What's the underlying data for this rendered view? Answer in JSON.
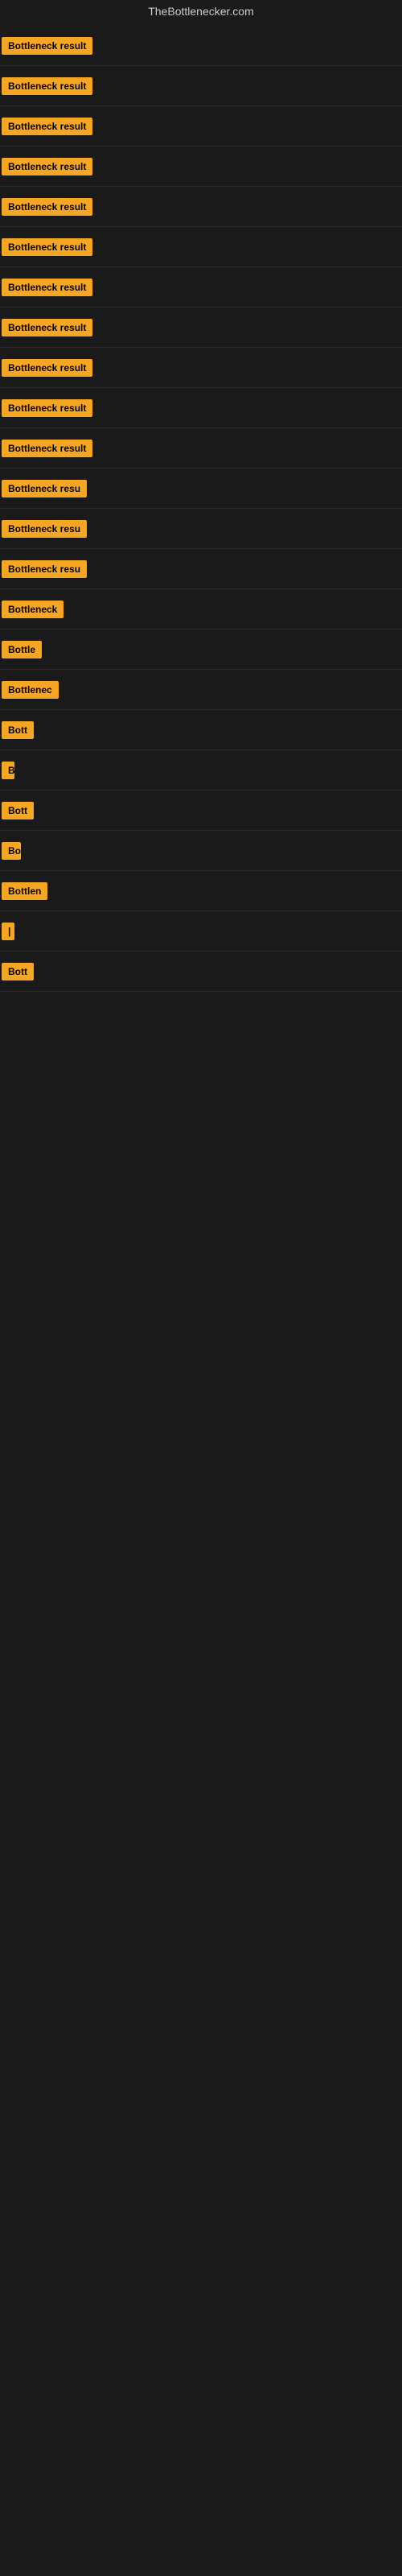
{
  "site": {
    "title": "TheBottlenecker.com"
  },
  "rows": [
    {
      "id": 1,
      "label": "Bottleneck result",
      "width": 155
    },
    {
      "id": 2,
      "label": "Bottleneck result",
      "width": 155
    },
    {
      "id": 3,
      "label": "Bottleneck result",
      "width": 155
    },
    {
      "id": 4,
      "label": "Bottleneck result",
      "width": 155
    },
    {
      "id": 5,
      "label": "Bottleneck result",
      "width": 155
    },
    {
      "id": 6,
      "label": "Bottleneck result",
      "width": 155
    },
    {
      "id": 7,
      "label": "Bottleneck result",
      "width": 155
    },
    {
      "id": 8,
      "label": "Bottleneck result",
      "width": 155
    },
    {
      "id": 9,
      "label": "Bottleneck result",
      "width": 155
    },
    {
      "id": 10,
      "label": "Bottleneck result",
      "width": 155
    },
    {
      "id": 11,
      "label": "Bottleneck result",
      "width": 155
    },
    {
      "id": 12,
      "label": "Bottleneck resu",
      "width": 130
    },
    {
      "id": 13,
      "label": "Bottleneck resu",
      "width": 130
    },
    {
      "id": 14,
      "label": "Bottleneck resu",
      "width": 130
    },
    {
      "id": 15,
      "label": "Bottleneck",
      "width": 90
    },
    {
      "id": 16,
      "label": "Bottle",
      "width": 55
    },
    {
      "id": 17,
      "label": "Bottlenec",
      "width": 80
    },
    {
      "id": 18,
      "label": "Bott",
      "width": 42
    },
    {
      "id": 19,
      "label": "B",
      "width": 14
    },
    {
      "id": 20,
      "label": "Bott",
      "width": 42
    },
    {
      "id": 21,
      "label": "Bo",
      "width": 24
    },
    {
      "id": 22,
      "label": "Bottlen",
      "width": 65
    },
    {
      "id": 23,
      "label": "|",
      "width": 8
    },
    {
      "id": 24,
      "label": "Bott",
      "width": 42
    }
  ]
}
